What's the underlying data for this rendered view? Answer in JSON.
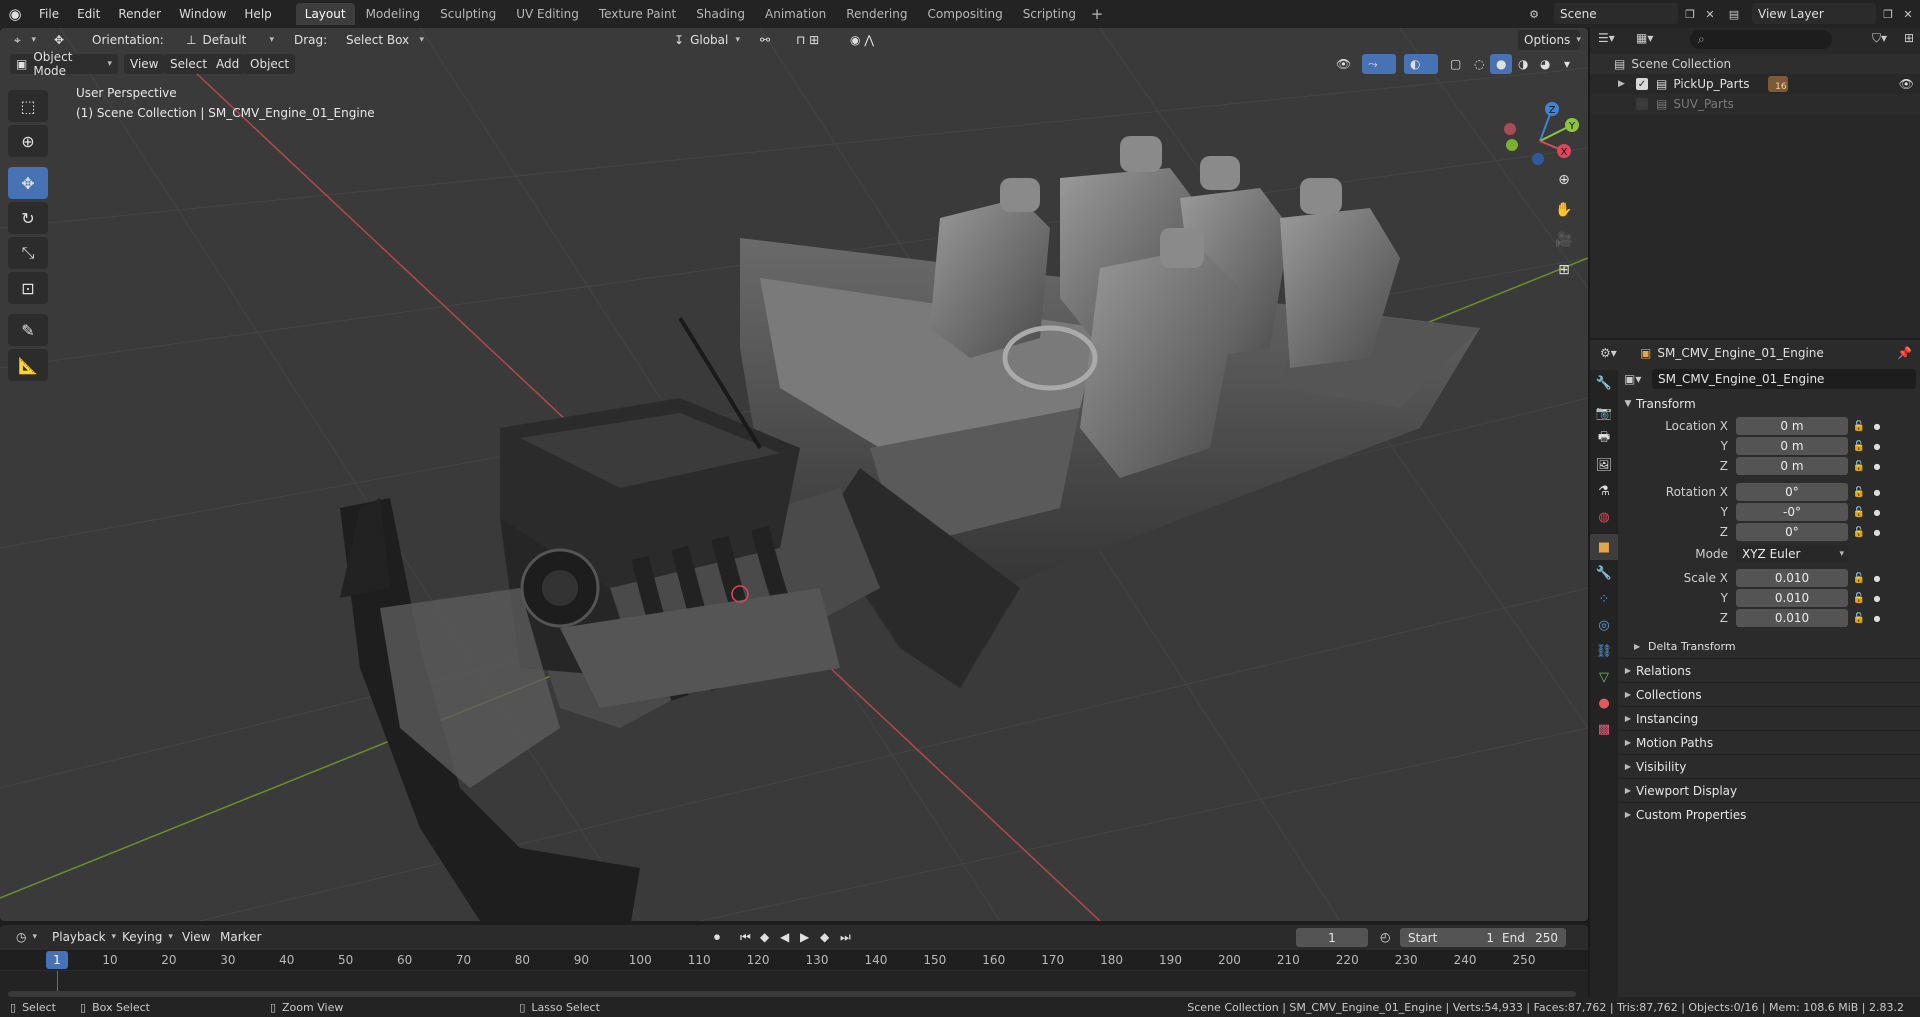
{
  "menu": {
    "items": [
      "File",
      "Edit",
      "Render",
      "Window",
      "Help"
    ]
  },
  "workspaces": {
    "tabs": [
      "Layout",
      "Modeling",
      "Sculpting",
      "UV Editing",
      "Texture Paint",
      "Shading",
      "Animation",
      "Rendering",
      "Compositing",
      "Scripting"
    ],
    "active": "Layout"
  },
  "scene": {
    "name": "Scene",
    "view_layer": "View Layer"
  },
  "viewport_header": {
    "orientation_label": "Orientation:",
    "orientation_value": "Default",
    "drag_label": "Drag:",
    "drag_value": "Select Box",
    "transform_orientation": "Global",
    "options": "Options"
  },
  "viewport_header2": {
    "mode": "Object Mode",
    "menus": [
      "View",
      "Select",
      "Add",
      "Object"
    ]
  },
  "viewport_overlay": {
    "perspective": "User Perspective",
    "collection_info": "(1) Scene Collection | SM_CMV_Engine_01_Engine"
  },
  "gizmo": {
    "x": "X",
    "y": "Y",
    "z": "Z"
  },
  "outliner": {
    "root": "Scene Collection",
    "items": [
      {
        "name": "PickUp_Parts",
        "checked": true,
        "badge": "16"
      },
      {
        "name": "SUV_Parts",
        "checked": false
      }
    ]
  },
  "properties": {
    "object_name": "SM_CMV_Engine_01_Engine",
    "data_name": "SM_CMV_Engine_01_Engine",
    "transform_title": "Transform",
    "location": {
      "label_x": "Location X",
      "x": "0 m",
      "y": "0 m",
      "z": "0 m"
    },
    "rotation": {
      "label_x": "Rotation X",
      "x": "0°",
      "y": "-0°",
      "z": "0°"
    },
    "mode_label": "Mode",
    "mode_value": "XYZ Euler",
    "scale": {
      "label_x": "Scale X",
      "x": "0.010",
      "y": "0.010",
      "z": "0.010"
    },
    "axis_y": "Y",
    "axis_z": "Z",
    "delta_transform": "Delta Transform",
    "collapsed_panels": [
      "Relations",
      "Collections",
      "Instancing",
      "Motion Paths",
      "Visibility",
      "Viewport Display",
      "Custom Properties"
    ]
  },
  "timeline": {
    "menus": [
      "Playback",
      "Keying",
      "View",
      "Marker"
    ],
    "current_frame": "1",
    "start_label": "Start",
    "start_value": "1",
    "end_label": "End",
    "end_value": "250",
    "ticks": [
      "1",
      "10",
      "20",
      "30",
      "40",
      "50",
      "60",
      "70",
      "80",
      "90",
      "100",
      "110",
      "120",
      "130",
      "140",
      "150",
      "160",
      "170",
      "180",
      "190",
      "200",
      "210",
      "220",
      "230",
      "240",
      "250"
    ]
  },
  "statusbar": {
    "select": "Select",
    "box_select": "Box Select",
    "zoom_view": "Zoom View",
    "lasso_select": "Lasso Select",
    "stats": "Scene Collection | SM_CMV_Engine_01_Engine | Verts:54,933 | Faces:87,762 | Tris:87,762 | Objects:0/16 | Mem: 108.6 MiB | 2.83.2"
  },
  "colors": {
    "accent": "#4772b3",
    "axis_x": "#e0475a",
    "axis_y": "#8cc63f",
    "axis_z": "#3d84d9"
  }
}
